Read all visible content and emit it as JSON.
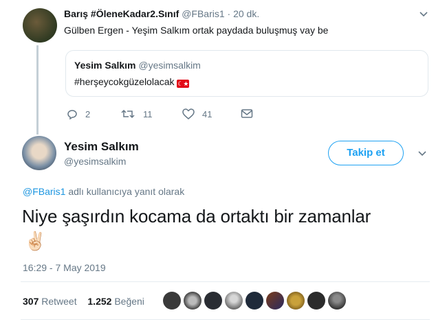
{
  "reply_tweet": {
    "display_name": "Barış #ÖleneKadar2.Sınıf",
    "handle": "@FBaris1",
    "separator": "·",
    "time_ago": "20 dk.",
    "text": "Gülben Ergen - Yeşim Salkım ortak paydada buluşmuş vay be",
    "quoted": {
      "display_name": "Yesim Salkım",
      "handle": "@yesimsalkim",
      "text": "#herşeycokgüzelolacak",
      "flag": "🇹🇷"
    },
    "actions": {
      "replies": "2",
      "retweets": "11",
      "likes": "41"
    }
  },
  "main_tweet": {
    "display_name": "Yesim Salkım",
    "handle": "@yesimsalkim",
    "follow_label": "Takip et",
    "reply_to_handle": "@FBaris1",
    "reply_to_suffix": "adlı kullanıcıya yanıt olarak",
    "text": "Niye şaşırdın kocama da ortaktı bir zamanlar",
    "emoji": "✌🏻",
    "timestamp": "16:29 - 7 May 2019",
    "retweet_count": "307",
    "retweet_label": "Retweet",
    "like_count": "1.252",
    "like_label": "Beğeni"
  },
  "colors": {
    "accent": "#1da1f2",
    "muted": "#657786",
    "heart": "#657786"
  },
  "icons": [
    "reply-icon",
    "retweet-icon",
    "like-icon",
    "dm-icon",
    "chevron-down-icon"
  ]
}
